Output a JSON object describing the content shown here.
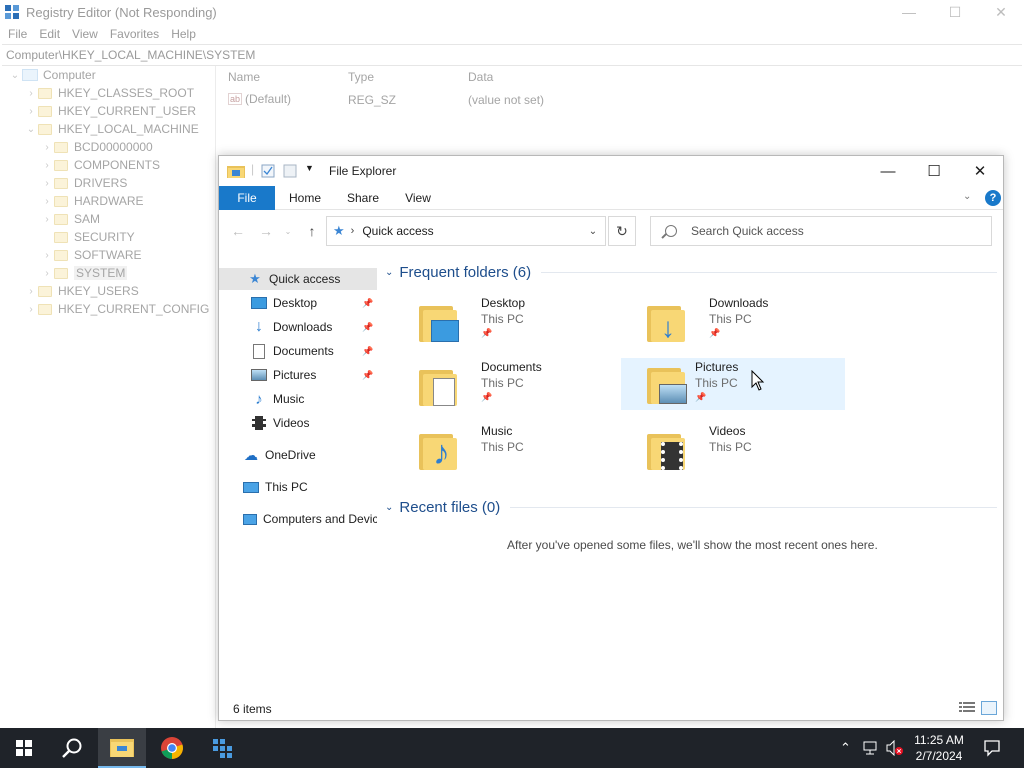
{
  "regedit": {
    "title": "Registry Editor (Not Responding)",
    "menu": [
      "File",
      "Edit",
      "View",
      "Favorites",
      "Help"
    ],
    "address": "Computer\\HKEY_LOCAL_MACHINE\\SYSTEM",
    "tree": {
      "root": "Computer",
      "hives": [
        "HKEY_CLASSES_ROOT",
        "HKEY_CURRENT_USER",
        "HKEY_LOCAL_MACHINE"
      ],
      "hklm_children": [
        "BCD00000000",
        "COMPONENTS",
        "DRIVERS",
        "HARDWARE",
        "SAM",
        "SECURITY",
        "SOFTWARE",
        "SYSTEM"
      ],
      "hives_after": [
        "HKEY_USERS",
        "HKEY_CURRENT_CONFIG"
      ]
    },
    "columns": {
      "name": "Name",
      "type": "Type",
      "data": "Data"
    },
    "row": {
      "name": "(Default)",
      "type": "REG_SZ",
      "data": "(value not set)",
      "icon": "ab-icon"
    }
  },
  "explorer": {
    "title": "File Explorer",
    "window_controls": {
      "minimize": "—",
      "maximize": "☐",
      "close": "✕"
    },
    "ribbon_tabs": {
      "file": "File",
      "home": "Home",
      "share": "Share",
      "view": "View"
    },
    "address_path": "Quick access",
    "search_placeholder": "Search Quick access",
    "sidebar": {
      "quick_access": "Quick access",
      "pinned": [
        "Desktop",
        "Downloads",
        "Documents",
        "Pictures"
      ],
      "unpinned": [
        "Music",
        "Videos"
      ],
      "onedrive": "OneDrive",
      "this_pc": "This PC",
      "network": "Computers and Devices"
    },
    "frequent_header": "Frequent folders (6)",
    "folders": [
      {
        "name": "Desktop",
        "location": "This PC",
        "pinned": true,
        "icon": "desktop-folder-icon"
      },
      {
        "name": "Downloads",
        "location": "This PC",
        "pinned": true,
        "icon": "downloads-folder-icon"
      },
      {
        "name": "Documents",
        "location": "This PC",
        "pinned": true,
        "icon": "documents-folder-icon"
      },
      {
        "name": "Pictures",
        "location": "This PC",
        "pinned": true,
        "icon": "pictures-folder-icon"
      },
      {
        "name": "Music",
        "location": "This PC",
        "pinned": false,
        "icon": "music-folder-icon"
      },
      {
        "name": "Videos",
        "location": "This PC",
        "pinned": false,
        "icon": "videos-folder-icon"
      }
    ],
    "recent_header": "Recent files (0)",
    "empty_message": "After you've opened some files, we'll show the most recent ones here.",
    "status": "6 items"
  },
  "taskbar": {
    "time": "11:25 AM",
    "date": "2/7/2024",
    "apps": [
      "start-icon",
      "search-icon",
      "file-explorer-icon",
      "chrome-icon",
      "regedit-icon"
    ]
  },
  "colors": {
    "accent": "#1979ca",
    "taskbar": "#1f2329",
    "hover": "#e5f3ff",
    "folder": "#f8d775"
  }
}
